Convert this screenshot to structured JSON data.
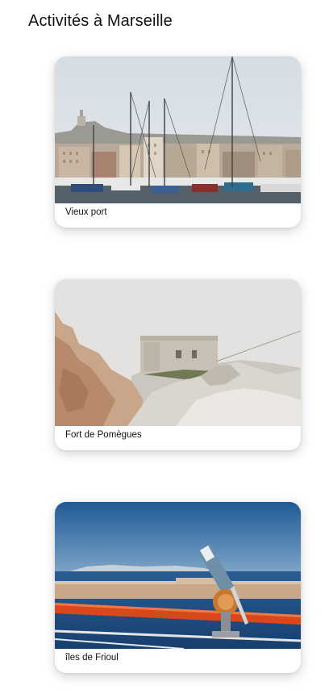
{
  "page": {
    "title": "Activités à Marseille"
  },
  "activities": [
    {
      "label": "Vieux port",
      "image": "harbor-photo"
    },
    {
      "label": "Fort de Pomègues",
      "image": "fort-on-rocks-photo"
    },
    {
      "label": "îles de Frioul",
      "image": "sea-view-telescope-photo"
    }
  ],
  "colors": {
    "text": "#111111",
    "card_background": "#ffffff",
    "sea": "#1f4f86",
    "railing": "#d9481c"
  }
}
